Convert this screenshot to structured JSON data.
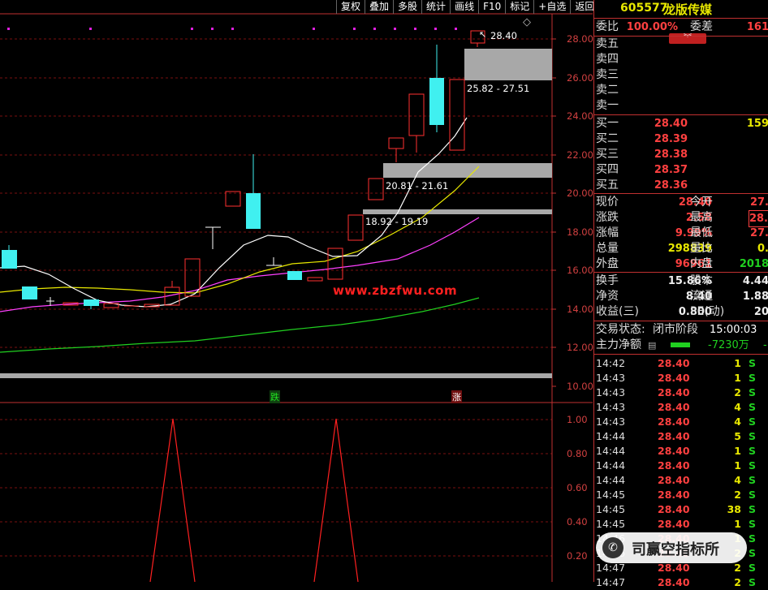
{
  "toolbar": {
    "items": [
      "复权",
      "叠加",
      "多股",
      "统计",
      "画线",
      "F10",
      "标记",
      "+自选",
      "返回"
    ]
  },
  "chart": {
    "price_ticks": [
      "28.00",
      "26.00",
      "24.00",
      "22.00",
      "20.00",
      "18.00",
      "16.00",
      "14.00",
      "12.00",
      "10.00"
    ],
    "indicator_ticks": [
      "1.00",
      "0.80",
      "0.60",
      "0.40",
      "0.20"
    ],
    "last_price_label": "28.40",
    "zone_labels": [
      "25.82 - 27.51",
      "20.81 - 21.61",
      "18.92 - 19.19"
    ],
    "watermark": "www.zbzfwu.com",
    "badge_down": "跌",
    "badge_up": "涨",
    "colors": {
      "up": "#ff3030",
      "down": "#40f0f0",
      "ma5": "#ffffff",
      "ma10": "#e8e800",
      "ma20": "#ff40ff",
      "ma60": "#20d020"
    }
  },
  "panel": {
    "code": "605577",
    "name": "龙版传媒",
    "weibi_label": "委比",
    "weibi_value": "100.00%",
    "weicha_label": "委差",
    "weicha_value": "161",
    "sell": [
      "卖五",
      "卖四",
      "卖三",
      "卖二",
      "卖一"
    ],
    "buy": [
      {
        "label": "买一",
        "price": "28.40",
        "vol": "159"
      },
      {
        "label": "买二",
        "price": "28.39",
        "vol": ""
      },
      {
        "label": "买三",
        "price": "28.38",
        "vol": ""
      },
      {
        "label": "买四",
        "price": "28.37",
        "vol": ""
      },
      {
        "label": "买五",
        "price": "28.36",
        "vol": ""
      }
    ],
    "stats": [
      {
        "l1": "现价",
        "v1": "28.40",
        "c1": "red",
        "l2": "今开",
        "v2": "27.",
        "c2": "red"
      },
      {
        "l1": "涨跌",
        "v1": "2.58",
        "c1": "red",
        "l2": "最高",
        "v2": "28.",
        "c2": "red"
      },
      {
        "l1": "涨幅",
        "v1": "9.99%",
        "c1": "red",
        "l2": "最低",
        "v2": "27.",
        "c2": "red"
      },
      {
        "l1": "总量",
        "v1": "298839",
        "c1": "yel",
        "l2": "量比",
        "v2": "0.",
        "c2": "yel"
      },
      {
        "l1": "外盘",
        "v1": "96961",
        "c1": "red",
        "l2": "内盘",
        "v2": "2018",
        "c2": "grn"
      }
    ],
    "stats2": [
      {
        "l1": "换手",
        "v1": "15.86%",
        "c1": "wht",
        "l2": "股本",
        "v2": "4.44",
        "c2": "wht"
      },
      {
        "l1": "净资",
        "v1": "8.40",
        "c1": "wht",
        "l2": "流通",
        "v2": "1.88",
        "c2": "wht"
      },
      {
        "l1": "收益(三)",
        "v1": "0.800",
        "c1": "wht",
        "l2": "PE(动)",
        "v2": "20",
        "c2": "wht"
      }
    ],
    "trade_status_label": "交易状态:",
    "trade_status_value": "闭市阶段",
    "trade_time": "15:00:03",
    "main_net_label": "主力净额",
    "main_net_value": "-7230万",
    "main_net_trail": "-",
    "ticks": [
      {
        "t": "14:42",
        "p": "28.40",
        "v": "1",
        "s": "S"
      },
      {
        "t": "14:43",
        "p": "28.40",
        "v": "1",
        "s": "S"
      },
      {
        "t": "14:43",
        "p": "28.40",
        "v": "2",
        "s": "S"
      },
      {
        "t": "14:43",
        "p": "28.40",
        "v": "4",
        "s": "S"
      },
      {
        "t": "14:43",
        "p": "28.40",
        "v": "4",
        "s": "S"
      },
      {
        "t": "14:44",
        "p": "28.40",
        "v": "5",
        "s": "S"
      },
      {
        "t": "14:44",
        "p": "28.40",
        "v": "1",
        "s": "S"
      },
      {
        "t": "14:44",
        "p": "28.40",
        "v": "1",
        "s": "S"
      },
      {
        "t": "14:44",
        "p": "28.40",
        "v": "4",
        "s": "S"
      },
      {
        "t": "14:45",
        "p": "28.40",
        "v": "2",
        "s": "S"
      },
      {
        "t": "14:45",
        "p": "28.40",
        "v": "38",
        "s": "S"
      },
      {
        "t": "14:45",
        "p": "28.40",
        "v": "1",
        "s": "S"
      },
      {
        "t": "14:46",
        "p": "28.40",
        "v": "1",
        "s": "S"
      },
      {
        "t": "14:46",
        "p": "28.40",
        "v": "2",
        "s": "S"
      },
      {
        "t": "14:47",
        "p": "28.40",
        "v": "2",
        "s": "S"
      },
      {
        "t": "14:47",
        "p": "28.40",
        "v": "2",
        "s": "S"
      }
    ],
    "wechat_badge": "司赢空指标所"
  }
}
